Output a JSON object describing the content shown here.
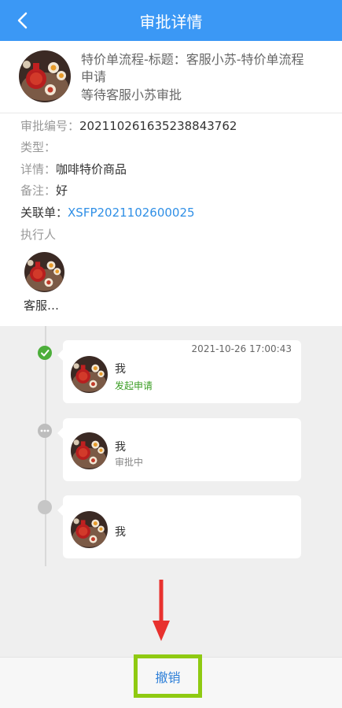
{
  "header": {
    "title": "审批详情"
  },
  "summary": {
    "line1": "特价单流程-标题：客服小苏-特价单流程",
    "line2": "申请",
    "line3": "等待客服小苏审批"
  },
  "details": {
    "approval_no_label": "审批编号：",
    "approval_no_value": "20211026163523884376​2",
    "type_label": "类型：",
    "detail_label": "详情：",
    "detail_value": "咖啡特价商品",
    "remark_label": "备注：",
    "remark_value": "好",
    "linked_label": "关联单：",
    "linked_value": "XSFP2021102600025",
    "executor_label": "执行人",
    "executor_name": "客服…"
  },
  "timeline": {
    "items": [
      {
        "time": "2021-10-26 17:00:43",
        "name": "我",
        "status": "发起申请",
        "state": "done"
      },
      {
        "name": "我",
        "status": "审批中",
        "state": "pending"
      },
      {
        "name": "我",
        "state": "waiting"
      }
    ]
  },
  "footer": {
    "cancel_label": "撤销"
  },
  "colors": {
    "accent": "#3b98f5",
    "link": "#2f8fe6",
    "success": "#4cae3a",
    "highlight": "#8fca12",
    "annotation_arrow": "#e8312e"
  }
}
